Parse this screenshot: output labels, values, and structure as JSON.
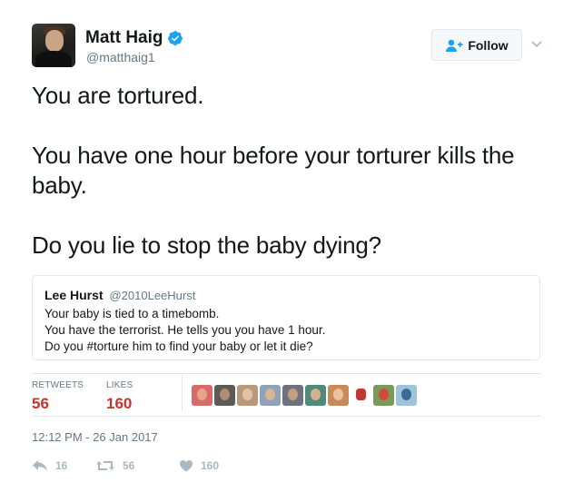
{
  "author": {
    "name": "Matt Haig",
    "handle": "@matthaig1"
  },
  "follow_button": {
    "label": "Follow"
  },
  "tweet": {
    "text": "You are tortured.\n\nYou have one hour before your torturer kills the baby.\n\nDo you lie to stop the baby dying?"
  },
  "quoted_tweet": {
    "name": "Lee Hurst",
    "handle": "@2010LeeHurst",
    "lines": [
      "Your baby is tied to a timebomb.",
      "You have the terrorist. He tells you you have 1 hour.",
      "Do you #torture him to find your baby or let it die?"
    ]
  },
  "stats": {
    "retweets_label": "RETWEETS",
    "retweets_value": "56",
    "likes_label": "LIKES",
    "likes_value": "160"
  },
  "timestamp": "12:12 PM - 26 Jan 2017",
  "actions": {
    "replies": "16",
    "retweets": "56",
    "likes": "160"
  },
  "colors": {
    "verified_blue": "#1da1f2",
    "stat_red": "#c7342b",
    "muted_gray": "#657786",
    "action_gray": "#aab8c2",
    "border": "#e1e8ed"
  }
}
